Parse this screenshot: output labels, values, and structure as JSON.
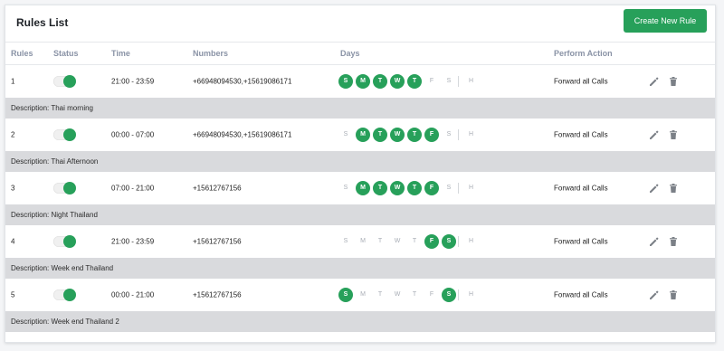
{
  "header": {
    "title": "Rules List",
    "create_button": "Create New Rule"
  },
  "columns": {
    "rules": "Rules",
    "status": "Status",
    "time": "Time",
    "numbers": "Numbers",
    "days": "Days",
    "action": "Perform Action"
  },
  "day_letters": [
    "S",
    "M",
    "T",
    "W",
    "T",
    "F",
    "S"
  ],
  "holiday_letter": "H",
  "colors": {
    "accent": "#27a05a",
    "description_bg": "#d9dadd",
    "icon": "#7b8087"
  },
  "rules": [
    {
      "id": "1",
      "status_on": true,
      "time": "21:00 - 23:59",
      "numbers": "+66948094530,+15619086171",
      "days_on": [
        true,
        true,
        true,
        true,
        true,
        false,
        false
      ],
      "action": "Forward all Calls",
      "description": "Description: Thai morning"
    },
    {
      "id": "2",
      "status_on": true,
      "time": "00:00 - 07:00",
      "numbers": "+66948094530,+15619086171",
      "days_on": [
        false,
        true,
        true,
        true,
        true,
        true,
        false
      ],
      "action": "Forward all Calls",
      "description": "Description: Thai Afternoon"
    },
    {
      "id": "3",
      "status_on": true,
      "time": "07:00 - 21:00",
      "numbers": "+15612767156",
      "days_on": [
        false,
        true,
        true,
        true,
        true,
        true,
        false
      ],
      "action": "Forward all Calls",
      "description": "Description: Night Thailand"
    },
    {
      "id": "4",
      "status_on": true,
      "time": "21:00 - 23:59",
      "numbers": "+15612767156",
      "days_on": [
        false,
        false,
        false,
        false,
        false,
        true,
        true
      ],
      "action": "Forward all Calls",
      "description": "Description: Week end Thailand"
    },
    {
      "id": "5",
      "status_on": true,
      "time": "00:00 - 21:00",
      "numbers": "+15612767156",
      "days_on": [
        true,
        false,
        false,
        false,
        false,
        false,
        true
      ],
      "action": "Forward all Calls",
      "description": "Description: Week end Thailand 2"
    }
  ]
}
